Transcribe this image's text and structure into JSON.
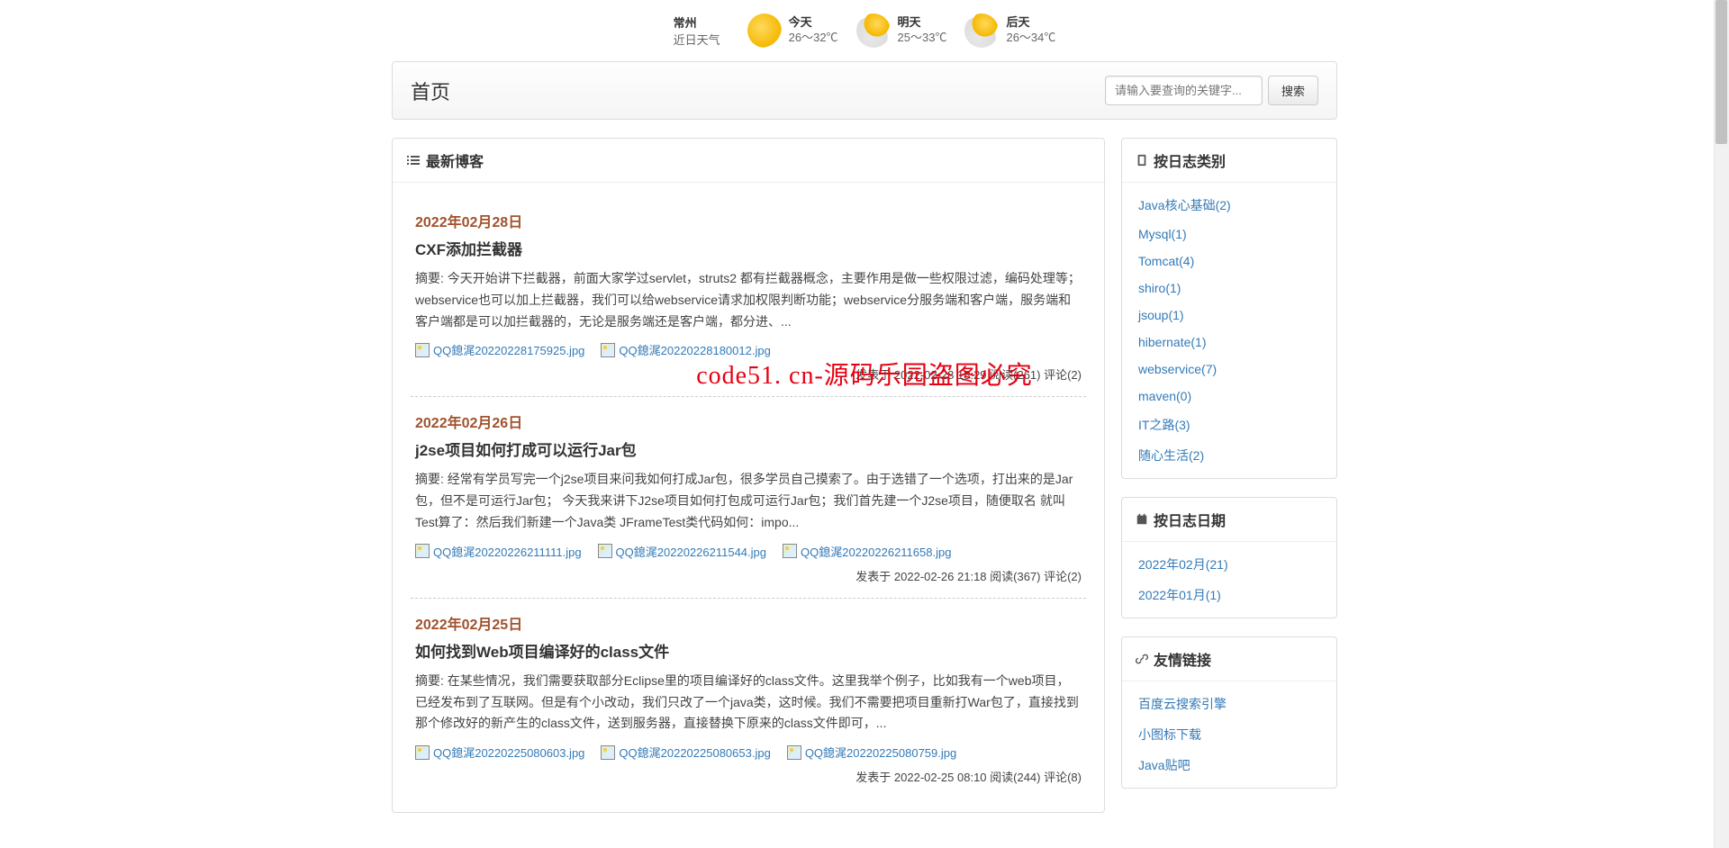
{
  "weather": {
    "city": "常州",
    "subtitle": "近日天气",
    "days": [
      {
        "label": "今天",
        "temp": "26～32℃",
        "icon": "sunny"
      },
      {
        "label": "明天",
        "temp": "25～33℃",
        "icon": "cloudy"
      },
      {
        "label": "后天",
        "temp": "26～34℃",
        "icon": "cloudy"
      }
    ]
  },
  "header": {
    "title": "首页",
    "search_placeholder": "请输入要查询的关键字...",
    "search_button": "搜索"
  },
  "latest_blogs_title": "最新博客",
  "posts": [
    {
      "date": "2022年02月28日",
      "title": "CXF添加拦截器",
      "summary": "摘要: 今天开始讲下拦截器，前面大家学过servlet，struts2 都有拦截器概念，主要作用是做一些权限过滤，编码处理等；webservice也可以加上拦截器，我们可以给webservice请求加权限判断功能；webservice分服务端和客户端，服务端和客户端都是可以加拦截器的，无论是服务端还是客户端，都分进、...",
      "images": [
        "QQ鎴浘20220228175925.jpg",
        "QQ鎴浘20220228180012.jpg"
      ],
      "meta": "发表于 2022-02-28 18:29 阅读(261) 评论(2)"
    },
    {
      "date": "2022年02月26日",
      "title": "j2se项目如何打成可以运行Jar包",
      "summary": "摘要: 经常有学员写完一个j2se项目来问我如何打成Jar包，很多学员自己摸索了。由于选错了一个选项，打出来的是Jar包，但不是可运行Jar包； 今天我来讲下J2se项目如何打包成可运行Jar包；我们首先建一个J2se项目，随便取名 就叫Test算了：然后我们新建一个Java类 JFrameTest类代码如何：impo...",
      "images": [
        "QQ鎴浘20220226211111.jpg",
        "QQ鎴浘20220226211544.jpg",
        "QQ鎴浘20220226211658.jpg"
      ],
      "meta": "发表于 2022-02-26 21:18 阅读(367) 评论(2)"
    },
    {
      "date": "2022年02月25日",
      "title": "如何找到Web项目编译好的class文件",
      "summary": "摘要: 在某些情况，我们需要获取部分Eclipse里的项目编译好的class文件。这里我举个例子，比如我有一个web项目，已经发布到了互联网。但是有个小改动，我们只改了一个java类，这时候。我们不需要把项目重新打War包了，直接找到那个修改好的新产生的class文件，送到服务器，直接替换下原来的class文件即可，...",
      "images": [
        "QQ鎴浘20220225080603.jpg",
        "QQ鎴浘20220225080653.jpg",
        "QQ鎴浘20220225080759.jpg"
      ],
      "meta": "发表于 2022-02-25 08:10 阅读(244) 评论(8)"
    }
  ],
  "sidebar": {
    "categories_title": "按日志类别",
    "categories": [
      "Java核心基础(2)",
      "Mysql(1)",
      "Tomcat(4)",
      "shiro(1)",
      "jsoup(1)",
      "hibernate(1)",
      "webservice(7)",
      "maven(0)",
      "IT之路(3)",
      "随心生活(2)"
    ],
    "dates_title": "按日志日期",
    "dates": [
      "2022年02月(21)",
      "2022年01月(1)"
    ],
    "links_title": "友情链接",
    "links": [
      "百度云搜索引擎",
      "小图标下载",
      "Java贴吧"
    ]
  },
  "watermark": "code51. cn-源码乐园盗图必究"
}
